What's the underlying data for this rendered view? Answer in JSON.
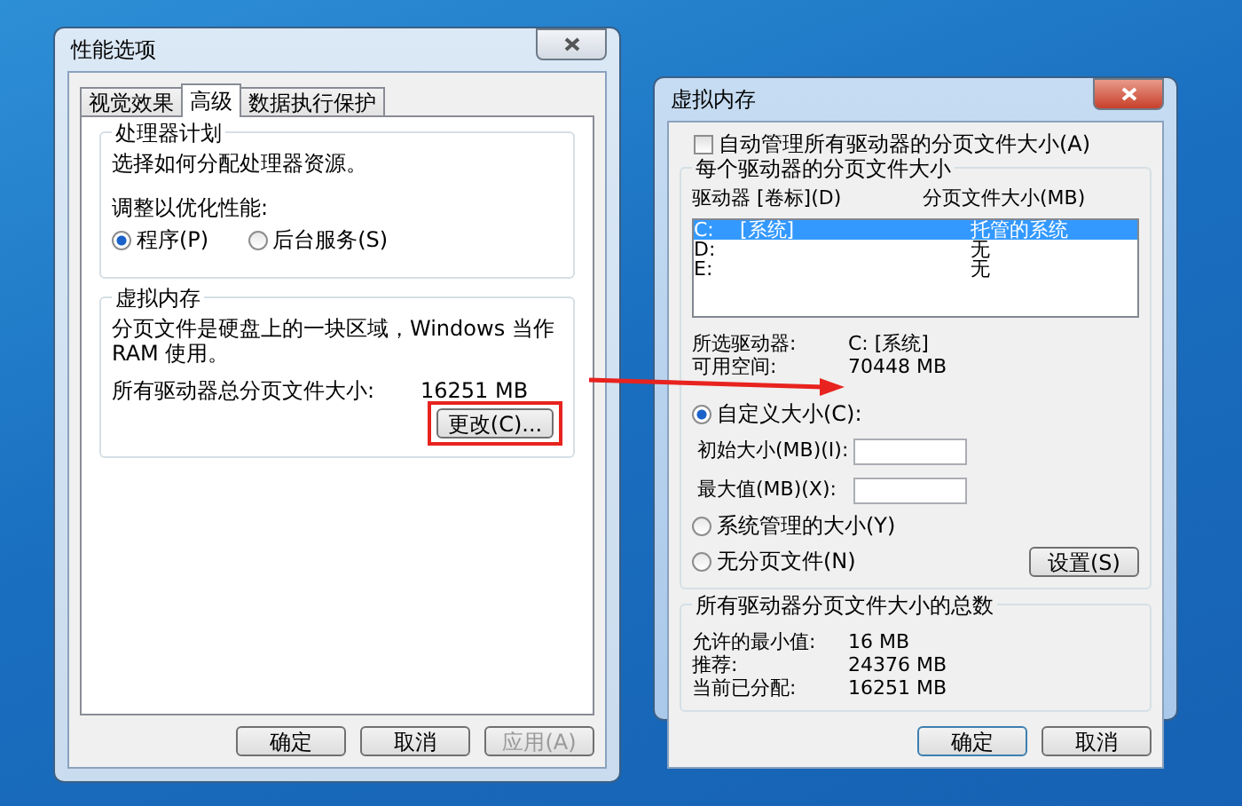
{
  "performance_options": {
    "title": "性能选项",
    "active": false,
    "tabs": [
      {
        "label": "视觉效果",
        "selected": false
      },
      {
        "label": "高级",
        "selected": true
      },
      {
        "label": "数据执行保护",
        "selected": false
      }
    ],
    "processor_group": {
      "title": "处理器计划",
      "description": "选择如何分配处理器资源。",
      "adjust_label": "调整以优化性能:",
      "options": [
        {
          "label": "程序(P)",
          "selected": true
        },
        {
          "label": "后台服务(S)",
          "selected": false
        }
      ]
    },
    "virtual_memory_group": {
      "title": "虚拟内存",
      "description": "分页文件是硬盘上的一块区域，Windows 当作 RAM 使用。",
      "total_label": "所有驱动器总分页文件大小:",
      "total_value": "16251 MB",
      "change_button": "更改(C)..."
    },
    "buttons": [
      {
        "label": "确定",
        "disabled": false
      },
      {
        "label": "取消",
        "disabled": false
      },
      {
        "label": "应用(A)",
        "disabled": true
      }
    ]
  },
  "virtual_memory": {
    "title": "虚拟内存",
    "active": true,
    "auto_manage": {
      "label": "自动管理所有驱动器的分页文件大小(A)",
      "checked": false
    },
    "per_drive_group": {
      "title": "每个驱动器的分页文件大小",
      "columns": [
        "驱动器 [卷标](D)",
        "分页文件大小(MB)"
      ],
      "drives": [
        {
          "drive": "C:",
          "label": "[系统]",
          "size": "托管的系统",
          "selected": true
        },
        {
          "drive": "D:",
          "size": "无",
          "selected": false
        },
        {
          "drive": "E:",
          "size": "无",
          "selected": false
        }
      ],
      "selected_drive_label": "所选驱动器:",
      "selected_drive_value": "C:  [系统]",
      "free_space_label": "可用空间:",
      "free_space_value": "70448 MB",
      "custom_option": {
        "label": "自定义大小(C):",
        "selected": true
      },
      "fields": [
        {
          "label": "初始大小(MB)(I):"
        },
        {
          "label": "最大值(MB)(X):"
        }
      ],
      "other_options": [
        {
          "label": "系统管理的大小(Y)",
          "selected": false
        },
        {
          "label": "无分页文件(N)",
          "selected": false
        }
      ],
      "set_button": "设置(S)"
    },
    "totals_group": {
      "title": "所有驱动器分页文件大小的总数",
      "rows": [
        {
          "label": "允许的最小值:",
          "value": "16 MB"
        },
        {
          "label": "推荐:",
          "value": "24376 MB"
        },
        {
          "label": "当前已分配:",
          "value": "16251 MB"
        }
      ]
    },
    "buttons": [
      {
        "label": "确定",
        "disabled": false
      },
      {
        "label": "取消",
        "disabled": false
      }
    ]
  }
}
